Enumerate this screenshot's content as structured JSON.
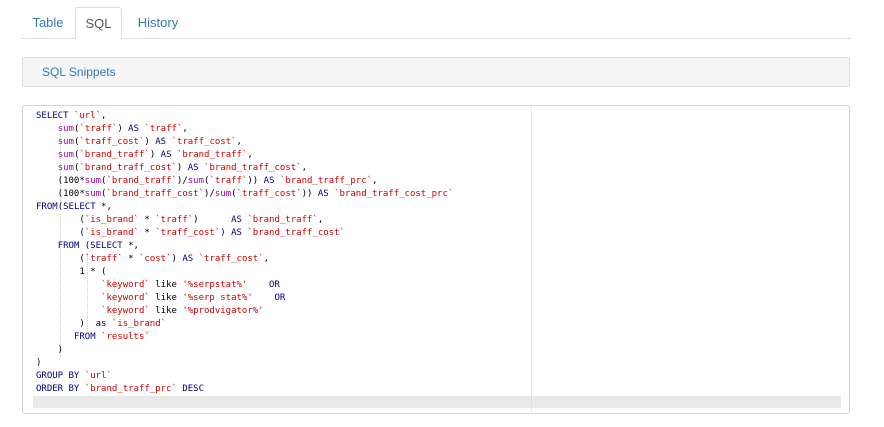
{
  "tabs": [
    {
      "label": "Table",
      "active": false
    },
    {
      "label": "SQL",
      "active": true
    },
    {
      "label": "History",
      "active": false
    }
  ],
  "snippets": {
    "label": "SQL Snippets"
  },
  "colors": {
    "link": "#337ab7",
    "keyword": "#000080",
    "function": "#aa00aa",
    "identifier": "#cc0000",
    "string": "#cc0000"
  },
  "editor": {
    "language": "SQL",
    "lines": [
      [
        [
          "kw",
          "SELECT "
        ],
        [
          "id",
          "`url`"
        ],
        [
          "op",
          ","
        ]
      ],
      [
        [
          "op",
          "    "
        ],
        [
          "fn",
          "sum"
        ],
        [
          "op",
          "("
        ],
        [
          "id",
          "`traff`"
        ],
        [
          "op",
          ") "
        ],
        [
          "kw",
          "AS "
        ],
        [
          "id",
          "`traff`"
        ],
        [
          "op",
          ","
        ]
      ],
      [
        [
          "op",
          "    "
        ],
        [
          "fn",
          "sum"
        ],
        [
          "op",
          "("
        ],
        [
          "id",
          "`traff_cost`"
        ],
        [
          "op",
          ") "
        ],
        [
          "kw",
          "AS "
        ],
        [
          "id",
          "`traff_cost`"
        ],
        [
          "op",
          ","
        ]
      ],
      [
        [
          "op",
          "    "
        ],
        [
          "fn",
          "sum"
        ],
        [
          "op",
          "("
        ],
        [
          "id",
          "`brand_traff`"
        ],
        [
          "op",
          ") "
        ],
        [
          "kw",
          "AS "
        ],
        [
          "id",
          "`brand_traff`"
        ],
        [
          "op",
          ","
        ]
      ],
      [
        [
          "op",
          "    "
        ],
        [
          "fn",
          "sum"
        ],
        [
          "op",
          "("
        ],
        [
          "id",
          "`brand_traff_cost`"
        ],
        [
          "op",
          ") "
        ],
        [
          "kw",
          "AS "
        ],
        [
          "id",
          "`brand_traff_cost`"
        ],
        [
          "op",
          ","
        ]
      ],
      [
        [
          "op",
          "    ("
        ],
        [
          "num",
          "100"
        ],
        [
          "op",
          "*"
        ],
        [
          "fn",
          "sum"
        ],
        [
          "op",
          "("
        ],
        [
          "id",
          "`brand_traff`"
        ],
        [
          "op",
          ")/"
        ],
        [
          "fn",
          "sum"
        ],
        [
          "op",
          "("
        ],
        [
          "id",
          "`traff`"
        ],
        [
          "op",
          "))"
        ],
        [
          "kw",
          " AS "
        ],
        [
          "id",
          "`brand_traff_prc`"
        ],
        [
          "op",
          ","
        ]
      ],
      [
        [
          "op",
          "    ("
        ],
        [
          "num",
          "100"
        ],
        [
          "op",
          "*"
        ],
        [
          "fn",
          "sum"
        ],
        [
          "op",
          "("
        ],
        [
          "id",
          "`brand_traff_cost`"
        ],
        [
          "op",
          ")/"
        ],
        [
          "fn",
          "sum"
        ],
        [
          "op",
          "("
        ],
        [
          "id",
          "`traff_cost`"
        ],
        [
          "op",
          "))"
        ],
        [
          "kw",
          " AS "
        ],
        [
          "id",
          "`brand_traff_cost_prc`"
        ]
      ],
      [
        [
          "kw",
          "FROM"
        ],
        [
          "op",
          "("
        ],
        [
          "kw",
          "SELECT "
        ],
        [
          "op",
          "*,"
        ]
      ],
      [
        [
          "op",
          "        ("
        ],
        [
          "id",
          "`is_brand`"
        ],
        [
          "op",
          " * "
        ],
        [
          "id",
          "`traff`"
        ],
        [
          "op",
          ")      "
        ],
        [
          "kw",
          "AS "
        ],
        [
          "id",
          "`brand_traff`"
        ],
        [
          "op",
          ","
        ]
      ],
      [
        [
          "op",
          "        ("
        ],
        [
          "id",
          "`is_brand`"
        ],
        [
          "op",
          " * "
        ],
        [
          "id",
          "`traff_cost`"
        ],
        [
          "op",
          ") "
        ],
        [
          "kw",
          "AS "
        ],
        [
          "id",
          "`brand_traff_cost`"
        ]
      ],
      [
        [
          "op",
          "    "
        ],
        [
          "kw",
          "FROM "
        ],
        [
          "op",
          "("
        ],
        [
          "kw",
          "SELECT "
        ],
        [
          "op",
          "*,"
        ]
      ],
      [
        [
          "op",
          "        ("
        ],
        [
          "id",
          "`traff`"
        ],
        [
          "op",
          " * "
        ],
        [
          "id",
          "`cost`"
        ],
        [
          "op",
          ") "
        ],
        [
          "kw",
          "AS "
        ],
        [
          "id",
          "`traff_cost`"
        ],
        [
          "op",
          ","
        ]
      ],
      [
        [
          "op",
          "        "
        ],
        [
          "num",
          "1"
        ],
        [
          "op",
          " * ("
        ]
      ],
      [
        [
          "op",
          "            "
        ],
        [
          "id",
          "`keyword`"
        ],
        [
          "op",
          " like "
        ],
        [
          "str",
          "'%serpstat%'"
        ],
        [
          "op",
          "    "
        ],
        [
          "kw",
          "OR"
        ]
      ],
      [
        [
          "op",
          "            "
        ],
        [
          "id",
          "`keyword`"
        ],
        [
          "op",
          " like "
        ],
        [
          "str",
          "'%serp stat%'"
        ],
        [
          "op",
          "    "
        ],
        [
          "kw",
          "OR"
        ]
      ],
      [
        [
          "op",
          "            "
        ],
        [
          "id",
          "`keyword`"
        ],
        [
          "op",
          " like "
        ],
        [
          "str",
          "'%prodvigator%'"
        ]
      ],
      [
        [
          "op",
          "        )  "
        ],
        [
          "kw",
          "as "
        ],
        [
          "id",
          "`is_brand`"
        ]
      ],
      [
        [
          "op",
          "       "
        ],
        [
          "kw",
          "FROM "
        ],
        [
          "id",
          "`results`"
        ]
      ],
      [
        [
          "op",
          "    )"
        ]
      ],
      [
        [
          "op",
          ")"
        ]
      ],
      [
        [
          "kw",
          "GROUP BY "
        ],
        [
          "id",
          "`url`"
        ]
      ],
      [
        [
          "kw",
          "ORDER BY "
        ],
        [
          "id",
          "`brand_traff_prc`"
        ],
        [
          "kw",
          " DESC"
        ]
      ]
    ]
  }
}
